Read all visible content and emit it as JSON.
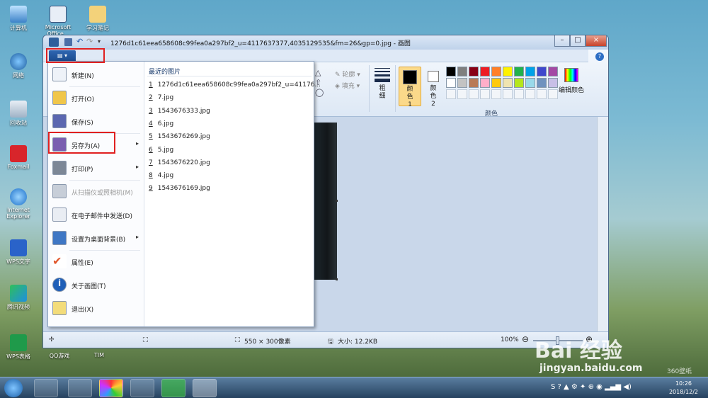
{
  "desktop": {
    "icons": [
      {
        "label": "计算机",
        "icon": "computer-icon"
      },
      {
        "label": "Microsoft Office...",
        "icon": "word-shortcut-icon"
      },
      {
        "label": "学习笔记",
        "icon": "folder-icon"
      },
      {
        "label": "网络",
        "icon": "network-icon"
      },
      {
        "label": "回收站",
        "icon": "recycle-bin-icon"
      },
      {
        "label": "Foxmail",
        "icon": "foxmail-icon"
      },
      {
        "label": "Internet Explorer",
        "icon": "ie-icon"
      },
      {
        "label": "WPS文字",
        "icon": "wps-writer-icon"
      },
      {
        "label": "腾讯视频",
        "icon": "tencent-video-icon"
      },
      {
        "label": "WPS表格",
        "icon": "wps-sheet-icon"
      },
      {
        "label": "QQ游戏",
        "icon": "qq-game-icon"
      },
      {
        "label": "TIM",
        "icon": "tim-icon"
      }
    ]
  },
  "window": {
    "title": "1276d1c61eea658608c99fea0a297bf2_u=4117637377,4035129535&fm=26&gp=0.jpg - 画图",
    "help": "?"
  },
  "ribbon": {
    "outline_label": "轮廓",
    "fill_label": "填充",
    "size_label": "粗细",
    "color1_label": "颜色 1",
    "color2_label": "颜色 2",
    "edit_colors_label": "编辑颜色",
    "colors_group_label": "颜色",
    "palette": [
      "#000000",
      "#7f7f7f",
      "#880015",
      "#ed1c24",
      "#ff7f27",
      "#fff200",
      "#22b14c",
      "#00a2e8",
      "#3f48cc",
      "#a349a4",
      "#ffffff",
      "#c3c3c3",
      "#b97a57",
      "#ffaec9",
      "#ffc90e",
      "#efe4b0",
      "#b5e61d",
      "#99d9ea",
      "#7092be",
      "#c8bfe7"
    ]
  },
  "file_menu": {
    "items": [
      {
        "label": "新建(N)",
        "icon": "new-file-icon",
        "submenu": false,
        "enabled": true
      },
      {
        "label": "打开(O)",
        "icon": "open-folder-icon",
        "submenu": false,
        "enabled": true
      },
      {
        "label": "保存(S)",
        "icon": "save-icon",
        "submenu": false,
        "enabled": true
      },
      {
        "label": "另存为(A)",
        "icon": "save-as-icon",
        "submenu": true,
        "enabled": true
      },
      {
        "label": "打印(P)",
        "icon": "printer-icon",
        "submenu": true,
        "enabled": true
      },
      {
        "label": "从扫描仪或照相机(M)",
        "icon": "scanner-icon",
        "submenu": false,
        "enabled": false
      },
      {
        "label": "在电子邮件中发送(D)",
        "icon": "email-icon",
        "submenu": false,
        "enabled": true
      },
      {
        "label": "设置为桌面背景(B)",
        "icon": "desktop-background-icon",
        "submenu": true,
        "enabled": true
      },
      {
        "label": "属性(E)",
        "icon": "properties-check-icon",
        "submenu": false,
        "enabled": true
      },
      {
        "label": "关于画图(T)",
        "icon": "info-icon",
        "submenu": false,
        "enabled": true
      },
      {
        "label": "退出(X)",
        "icon": "exit-icon",
        "submenu": false,
        "enabled": true
      }
    ],
    "recent_title": "最近的图片",
    "recent": [
      {
        "num": "1",
        "name": "1276d1c61eea658608c99fea0a297bf2_u=41176..."
      },
      {
        "num": "2",
        "name": "7.jpg"
      },
      {
        "num": "3",
        "name": "1543676333.jpg"
      },
      {
        "num": "4",
        "name": "6.jpg"
      },
      {
        "num": "5",
        "name": "1543676269.jpg"
      },
      {
        "num": "6",
        "name": "5.jpg"
      },
      {
        "num": "7",
        "name": "1543676220.jpg"
      },
      {
        "num": "8",
        "name": "4.jpg"
      },
      {
        "num": "9",
        "name": "1543676169.jpg"
      }
    ]
  },
  "statusbar": {
    "dimensions": "550 × 300像素",
    "size": "大小: 12.2KB",
    "zoom": "100%"
  },
  "taskbar": {
    "time": "10:26",
    "date": "2018/12/2"
  },
  "watermark": {
    "brand": "Bai 经验",
    "url": "jingyan.baidu.com",
    "corner": "360壁纸"
  }
}
